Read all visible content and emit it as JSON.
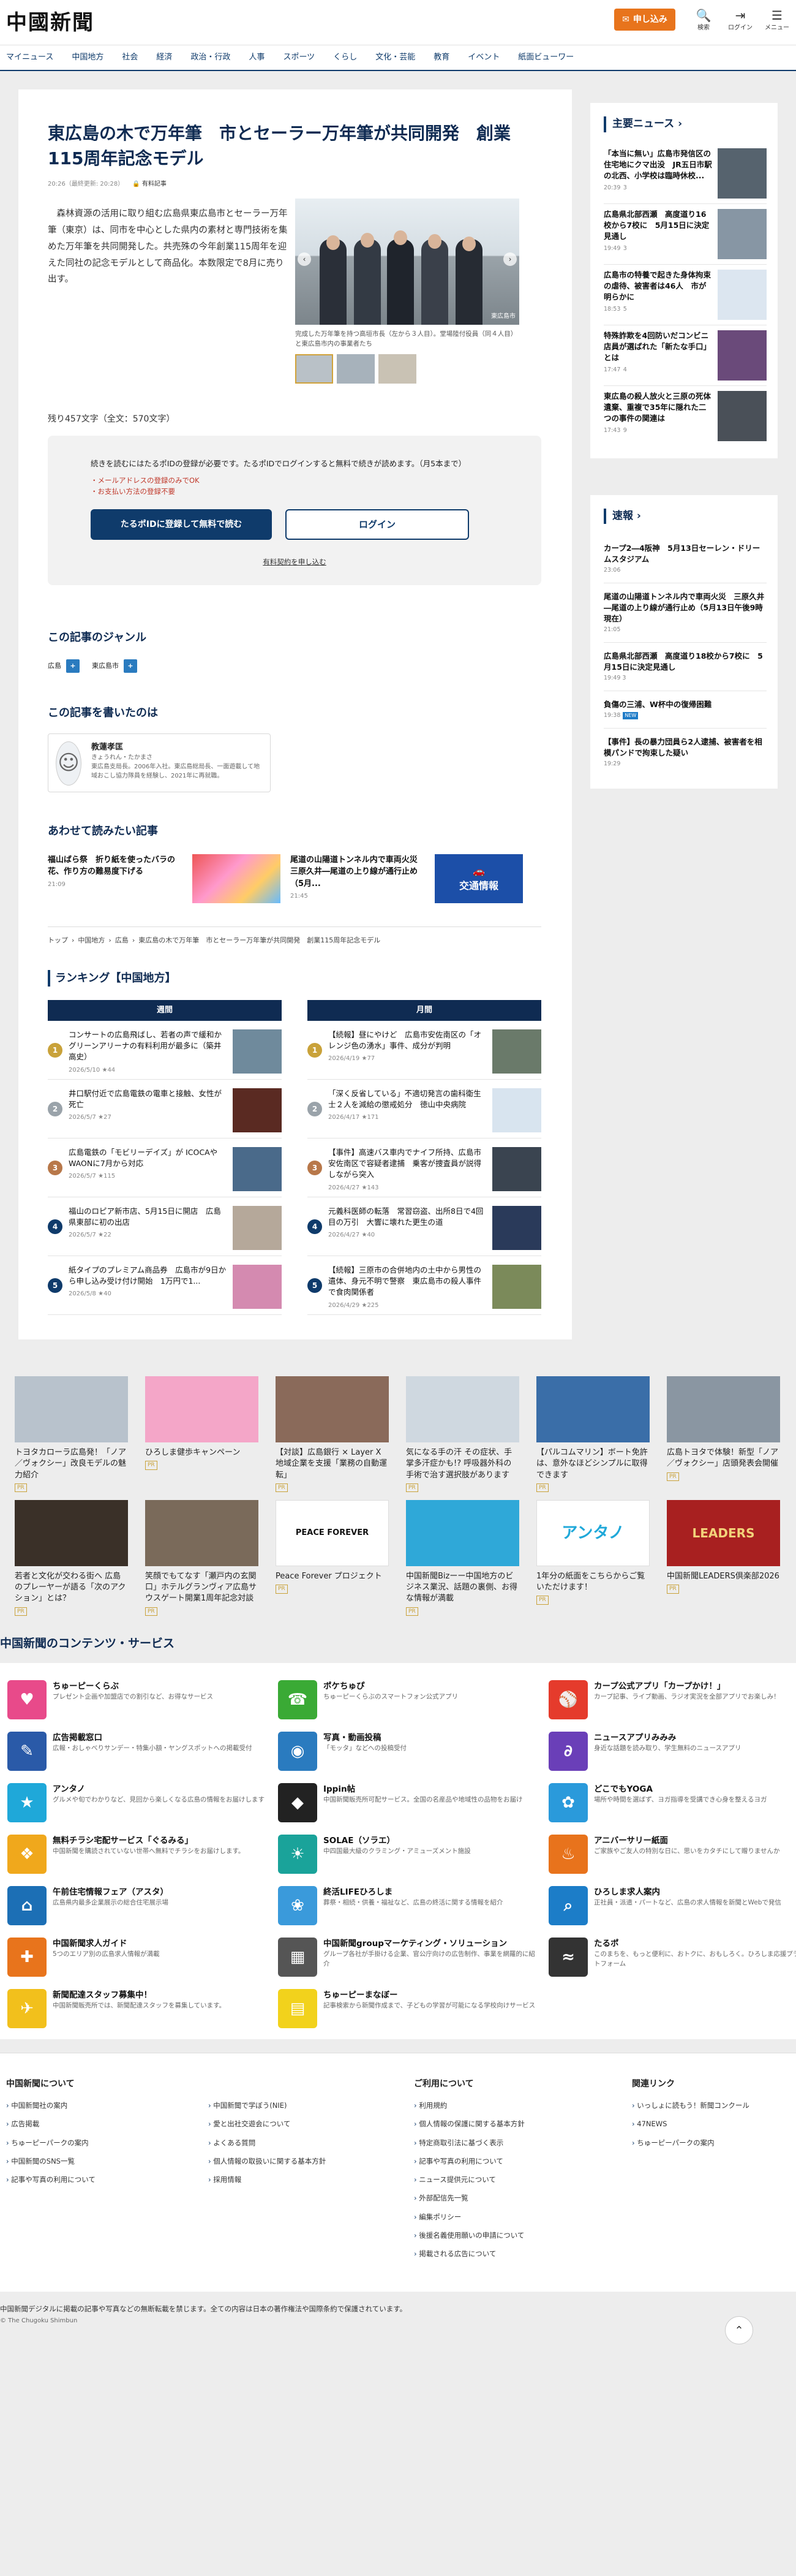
{
  "header": {
    "logo": "中國新聞",
    "subscribe": "申し込み",
    "icons": [
      {
        "icon": "search-icon",
        "label": "検索"
      },
      {
        "icon": "login-icon",
        "label": "ログイン"
      },
      {
        "icon": "menu-icon",
        "label": "メニュー"
      }
    ]
  },
  "nav": [
    "マイニュース",
    "中国地方",
    "社会",
    "経済",
    "政治・行政",
    "人事",
    "スポーツ",
    "くらし",
    "文化・芸能",
    "教育",
    "イベント",
    "紙面ビューワー"
  ],
  "article": {
    "title": "東広島の木で万年筆　市とセーラー万年筆が共同開発　創業115周年記念モデル",
    "date": "20:26（最終更新: 20:28）",
    "category": "有料記事",
    "lead": "森林資源の活用に取り組む広島県東広島市とセーラー万年筆（東京）は、同市を中心とした県内の素材と専門技術を集めた万年筆を共同開発した。共売殊の今年創業115周年を迎えた同社の記念モデルとして商品化。本数限定で8月に売り出す。",
    "caption": "完成した万年筆を持つ高垣市長（左から３人目）。堂場陸付役員（同４人目）と東広島市内の事業者たち",
    "credit": "東広島市",
    "remaining": "残り457文字（全文：570文字）",
    "paywall_msg": "続きを読むにはたるポIDの登録が必要です。たるポIDでログインすると無料で続きが読めます。（月5本まで）",
    "paywall_notes": [
      "・メールアドレスの登録のみでOK",
      "・お支払い方法の登録不要"
    ],
    "register_btn": "たるポIDに登録して無料で読む",
    "login_btn": "ログイン",
    "terms": "有料契約を申し込む"
  },
  "genre": {
    "heading": "この記事のジャンル",
    "tags": [
      "広島",
      "東広島市"
    ]
  },
  "author": {
    "heading": "この記事を書いたのは",
    "name": "教蓮孝匡",
    "kana": "きょうれん・たかまさ",
    "bio": "東広島支局長。2006年入社。東広島総局長、一面遊載して地域おこし協力隊員を経験し、2021年に再就職。"
  },
  "related": {
    "heading": "あわせて読みたい記事",
    "items": [
      {
        "title": "福山ばら祭　折り紙を使ったバラの花、作り方の難易度下げる",
        "date": "21:09"
      },
      {
        "title": "尾道の山陽道トンネル内で車両火災　三原久井―尾道の上り線が通行止め（5月...",
        "date": "21:45",
        "badge": "交通情報"
      }
    ]
  },
  "breadcrumb": [
    "トップ",
    "中国地方",
    "広島",
    "東広島の木で万年筆　市とセーラー万年筆が共同開発　創業115周年記念モデル"
  ],
  "ranking": {
    "heading": "ランキング【中国地方】",
    "weekly_label": "週間",
    "monthly_label": "月間",
    "weekly": [
      {
        "title": "コンサートの広島飛ばし、若者の声で緩和か　グリーンアリーナの有料利用が最多に（築井高史）",
        "date": "2026/5/10",
        "count": "44"
      },
      {
        "title": "井口駅付近で広島電鉄の電車と接触、女性が死亡",
        "date": "2026/5/7",
        "count": "27"
      },
      {
        "title": "広島電鉄の「モビリーデイズ」が ICOCAやWAONに7月から対応",
        "date": "2026/5/7",
        "count": "115"
      },
      {
        "title": "福山のロピア新市店、5月15日に開店　広島県東部に初の出店",
        "date": "2026/5/7",
        "count": "22"
      },
      {
        "title": "紙タイプのプレミアム商品券　広島市が9日から申し込み受け付け開始　1万円で1...",
        "date": "2026/5/8",
        "count": "40"
      }
    ],
    "monthly": [
      {
        "title": "【続報】昼にやけど　広島市安佐南区の「オレンジ色の湧水」事件、成分が判明",
        "date": "2026/4/19",
        "count": "77"
      },
      {
        "title": "「深く反省している」不適切発言の歯科衛生士２人を減給の懲戒処分　徳山中央病院",
        "date": "2026/4/17",
        "count": "171"
      },
      {
        "title": "【事件】高速バス車内でナイフ所持、広島市安佐南区で容疑者逮捕　乗客が捜査員が説得しながら突入",
        "date": "2026/4/27",
        "count": "143"
      },
      {
        "title": "元義科医師の転落　常習窃盗、出所8日で4回目の万引　大響に壊れた更生の道",
        "date": "2026/4/27",
        "count": "40"
      },
      {
        "title": "【続報】三原市の合併地内の土中から男性の遺体、身元不明で警察　東広島市の殺人事件で食肉関係者",
        "date": "2026/4/29",
        "count": "225"
      }
    ]
  },
  "side_main": {
    "heading": "主要ニュース",
    "items": [
      {
        "title": "「本当に無い」広島市発信区の住宅地にクマ出没　JR五日市駅の北西、小学校は臨時休校...",
        "date": "20:39",
        "count": "3"
      },
      {
        "title": "広島県北部西瀬　高度道り16校から7校に　5月15日に決定見通し",
        "date": "19:49",
        "count": "3"
      },
      {
        "title": "広島市の特養で起きた身体拘束の虐待、被害者は46人　市が明らかに",
        "date": "18:53",
        "count": "5"
      },
      {
        "title": "特殊詐欺を4回防いだコンビニ店員が選ばれた「新たな手口」とは",
        "date": "17:47",
        "count": "4"
      },
      {
        "title": "東広島の殺人放火と三原の死体遺棄、重複で35年に隠れた二つの事件の関連は",
        "date": "17:43",
        "count": "9"
      }
    ]
  },
  "side_flash": {
    "heading": "速報",
    "items": [
      {
        "title": "カープ2―4阪神　5月13日セーレン・ドリームスタジアム",
        "date": "23:06"
      },
      {
        "title": "尾道の山陽道トンネル内で車両火災　三原久井―尾道の上り線が通行止め（5月13日午後9時現在）",
        "date": "21:05"
      },
      {
        "title": "広島県北部西瀬　高度道り18校から7校に　5月15日に決定見通し",
        "date": "19:49",
        "count": "3"
      },
      {
        "title": "負傷の三浦、W杯中の復帰困難",
        "date": "19:38",
        "new": "NEW"
      },
      {
        "title": "【事件】長の暴力団員ら2人逮捕、被害者を相模パンドで拘束した疑い",
        "date": "19:29"
      }
    ]
  },
  "promos": [
    {
      "title": "トヨタカローラ広島発！「ノア／ヴォクシー」改良モデルの魅力紹介",
      "pr": "PR"
    },
    {
      "title": "ひろしま健歩キャンペーン",
      "pr": "PR"
    },
    {
      "title": "【対談】広島銀行 × Layer X　地域企業を支援「業務の自動運転」",
      "pr": "PR"
    },
    {
      "title": "気になる手の汗 その症状、手掌多汗症かも!? 呼吸器外科の手術で治す選択肢があります",
      "pr": "PR"
    },
    {
      "title": "【パルコムマリン】ボート免許は、意外なほどシンプルに取得できます",
      "pr": "PR"
    },
    {
      "title": "広島トヨタで体験！新型「ノア／ヴォクシー」店頭発表会開催",
      "pr": "PR"
    },
    {
      "title": "若者と文化が交わる街へ 広島のプレーヤーが語る「次のアクション」とは？",
      "pr": "PR"
    },
    {
      "title": "笑顔でもてなす「瀬戸内の玄関口」ホテルグランヴィア広島サウスゲート開業1周年記念対談",
      "pr": "PR"
    },
    {
      "title": "Peace Forever プロジェクト",
      "pr": "PR"
    },
    {
      "title": "中国新聞Bizーー中国地方のビジネス業況、話題の裏側、お得な情報が満載",
      "pr": "PR"
    },
    {
      "title": "1年分の紙面をこちらからご覧いただけます！",
      "pr": "PR"
    },
    {
      "title": "中国新聞LEADERS倶楽部2026",
      "pr": "PR"
    }
  ],
  "services": {
    "heading": "中国新聞のコンテンツ・サービス",
    "items": [
      {
        "name": "ちゅーピーくらぶ",
        "desc": "プレゼント企画や加盟店での割引など、お得なサービス",
        "color": "#e84a8a",
        "icon": "heart-icon"
      },
      {
        "name": "ポケちゅぴ",
        "desc": "ちゅーピーくらぶのスマートフォン公式アプリ",
        "color": "#3aaa35",
        "icon": "phone-icon"
      },
      {
        "name": "カープ公式アプリ「カープかけ！」",
        "desc": "カープ記事、ライブ動画、ラジオ実況を全部アプリでお楽しみ！",
        "color": "#e53b2c",
        "icon": "baseball-icon"
      },
      {
        "name": "広告掲載窓口",
        "desc": "広報・おしゃべりサンデー・特集小額・ヤングスポットへの掲載受付",
        "color": "#2a5aa8",
        "icon": "newspaper-icon"
      },
      {
        "name": "写真・動画投稿",
        "desc": "「モッタ」などへの投稿受付",
        "color": "#2a7bbf",
        "icon": "camera-icon"
      },
      {
        "name": "ニュースアプリみみみ",
        "desc": "身近な話題を読み取り、学生無料のニュースアプリ",
        "color": "#6a3fb8",
        "icon": "app-icon"
      },
      {
        "name": "アンタノ",
        "desc": "グルメや旬でわかりなど、見回から楽しくなる広島の情報をお届けします",
        "color": "#1fa8d9",
        "icon": "star-icon"
      },
      {
        "name": "Ippin帖",
        "desc": "中国新聞販売所可配サービス。全国の名産品や地域性の品物をお届け",
        "color": "#222222",
        "icon": "gift-icon"
      },
      {
        "name": "どこでもYOGA",
        "desc": "場所や時間を選ばず、ヨガ指導を受講でき心身を整えるヨガ",
        "color": "#2a9adb",
        "icon": "yoga-icon"
      },
      {
        "name": "無料チラシ宅配サービス「ぐるみる」",
        "desc": "中国新聞を購読されていない世帯へ無料でチラシをお届けします。",
        "color": "#f0a81c",
        "icon": "leaflet-icon"
      },
      {
        "name": "SOLAE（ソラエ）",
        "desc": "中四国最大級のクラミング・アミューズメント施設",
        "color": "#1aa39a",
        "icon": "sun-icon"
      },
      {
        "name": "アニバーサリー紙面",
        "desc": "ご家族やご友人の特別な日に、思いをカタチにして贈りませんか",
        "color": "#e8731c",
        "icon": "cake-icon"
      },
      {
        "name": "午前住宅情報フェア（アスタ）",
        "desc": "広島県内最多企業展示の総合住宅展示場",
        "color": "#1c6fb5",
        "icon": "house-icon"
      },
      {
        "name": "終活LIFEひろしま",
        "desc": "葬祭・相続・供養・福祉など、広島の終活に関する情報を紹介",
        "color": "#3a9adb",
        "icon": "flower-icon"
      },
      {
        "name": "ひろしま求人案内",
        "desc": "正社員・派遣・パートなど、広島の求人情報を新聞とWebで発信",
        "color": "#1c7dc8",
        "icon": "search-icon"
      },
      {
        "name": "中国新聞求人ガイド",
        "desc": "5つのエリア別の広島求人情報が満載",
        "color": "#e8741c",
        "icon": "job-icon"
      },
      {
        "name": "中国新聞groupマーケティング・ソリューション",
        "desc": "グループ各社が手掛ける企業、官公庁向けの広告制作、事業を網羅的に紹介",
        "color": "#555555",
        "icon": "chart-icon"
      },
      {
        "name": "たるポ",
        "desc": "このまちを、もっと便利に、おトクに、おもしろく。ひろしま応援プラットフォーム",
        "color": "#333333",
        "icon": "wave-icon"
      },
      {
        "name": "新聞配達スタッフ募集中！",
        "desc": "中国新聞販売所では、新聞配達スタッフを募集しています。",
        "color": "#f2c01c",
        "icon": "delivery-icon"
      },
      {
        "name": "ちゅーピーまなぼー",
        "desc": "記事検索から新聞作成まで、子どもの学習が可能になる学校向けサービス",
        "color": "#f2d21c",
        "icon": "book-icon"
      }
    ]
  },
  "footer": {
    "col1": {
      "heading": "中国新聞について",
      "links": [
        "中国新聞社の案内",
        "広告掲載",
        "ちゅーピーパークの案内",
        "中国新聞のSNS一覧",
        "記事や写真の利用について"
      ]
    },
    "col1b": {
      "links": [
        "中国新聞で学ぼう(NIE)",
        "愛と出社交遊会について",
        "よくある質問",
        "個人情報の取扱いに関する基本方針",
        "採用情報"
      ]
    },
    "col2": {
      "heading": "ご利用について",
      "links": [
        "利用規約",
        "個人情報の保護に関する基本方針",
        "特定商取引法に基づく表示",
        "記事や写真の利用について",
        "ニュース提供元について",
        "外部配信先一覧",
        "編集ポリシー",
        "後援名義使用願いの申請について",
        "掲載される広告について"
      ]
    },
    "col3": {
      "heading": "関連リンク",
      "links": [
        "いっしょに読もう！新聞コンクール",
        "47NEWS",
        "ちゅーピーパークの案内"
      ]
    },
    "notice": "中国新聞デジタルに掲載の記事や写真などの無断転載を禁じます。全ての内容は日本の著作権法や国際条約で保護されています。",
    "copyright": "© The Chugoku Shimbun"
  }
}
